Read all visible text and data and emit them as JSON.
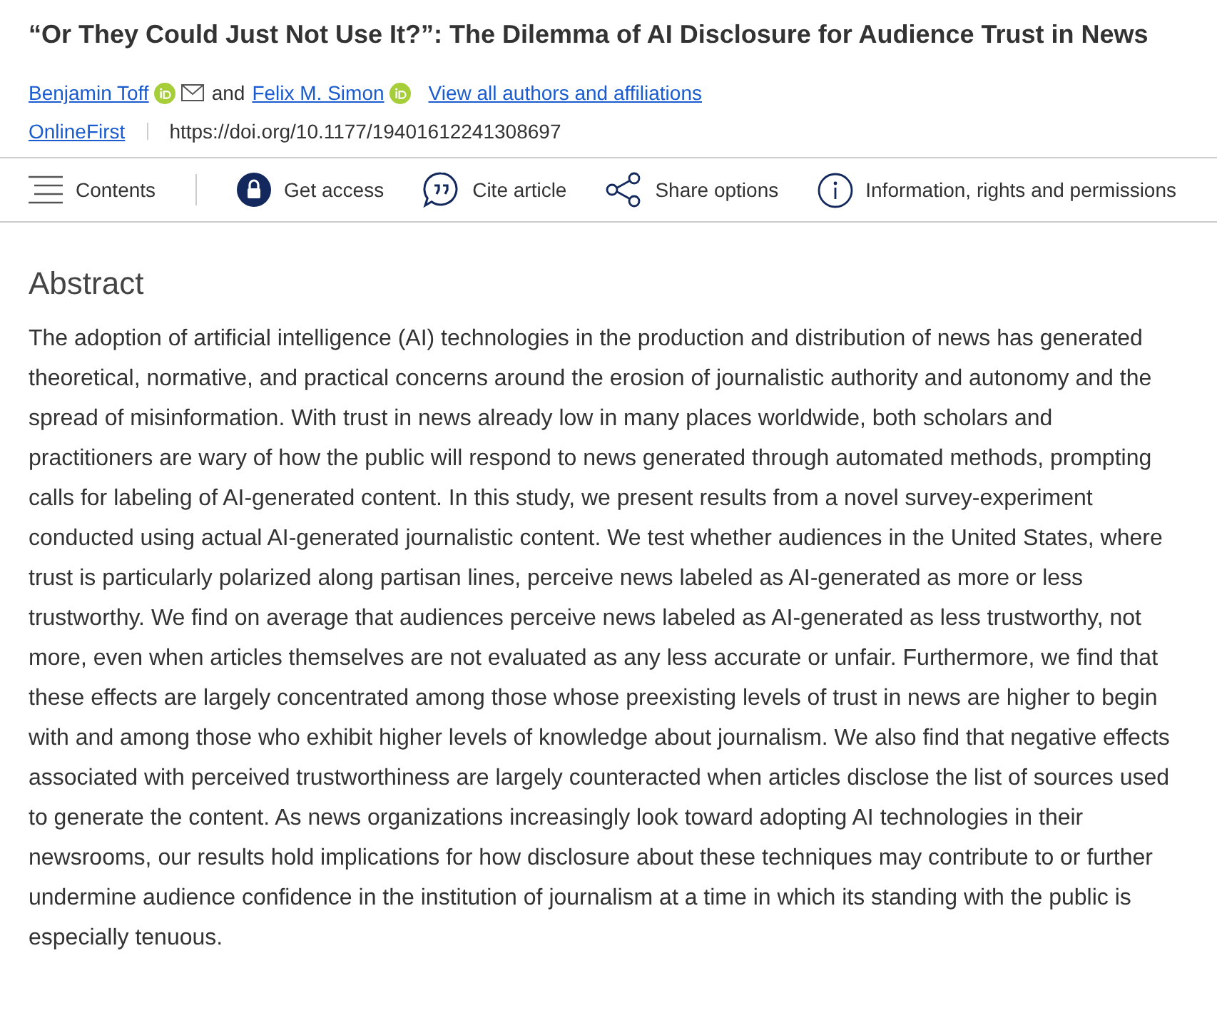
{
  "title": "“Or They Could Just Not Use It?”: The Dilemma of AI Disclosure for Audience Trust in News",
  "authors": [
    {
      "name": "Benjamin Toff",
      "orcid": true,
      "email": true
    },
    {
      "name": "Felix M. Simon",
      "orcid": true,
      "email": false
    }
  ],
  "author_joiner": "and",
  "all_authors_link": "View all authors and affiliations",
  "status_link": "OnlineFirst",
  "doi": "https://doi.org/10.1177/19401612241308697",
  "toolbar": [
    {
      "kind": "menu",
      "label": "Contents"
    },
    {
      "kind": "lock",
      "label": "Get access"
    },
    {
      "kind": "quote",
      "label": "Cite article"
    },
    {
      "kind": "share",
      "label": "Share options"
    },
    {
      "kind": "info",
      "label": "Information, rights and permissions"
    }
  ],
  "abstract": {
    "heading": "Abstract",
    "text": "The adoption of artificial intelligence (AI) technologies in the production and distribution of news has generated theoretical, normative, and practical concerns around the erosion of journalistic authority and autonomy and the spread of misinformation. With trust in news already low in many places worldwide, both scholars and practitioners are wary of how the public will respond to news generated through automated methods, prompting calls for labeling of AI-generated content. In this study, we present results from a novel survey-experiment conducted using actual AI-generated journalistic content. We test whether audiences in the United States, where trust is particularly polarized along partisan lines, perceive news labeled as AI-generated as more or less trustworthy. We find on average that audiences perceive news labeled as AI-generated as less trustworthy, not more, even when articles themselves are not evaluated as any less accurate or unfair. Furthermore, we find that these effects are largely concentrated among those whose preexisting levels of trust in news are higher to begin with and among those who exhibit higher levels of knowledge about journalism. We also find that negative effects associated with perceived trustworthiness are largely counteracted when articles disclose the list of sources used to generate the content. As news organizations increasingly look toward adopting AI technologies in their newsrooms, our results hold implications for how disclosure about these techniques may contribute to or further undermine audience confidence in the institution of journalism at a time in which its standing with the public is especially tenuous."
  }
}
